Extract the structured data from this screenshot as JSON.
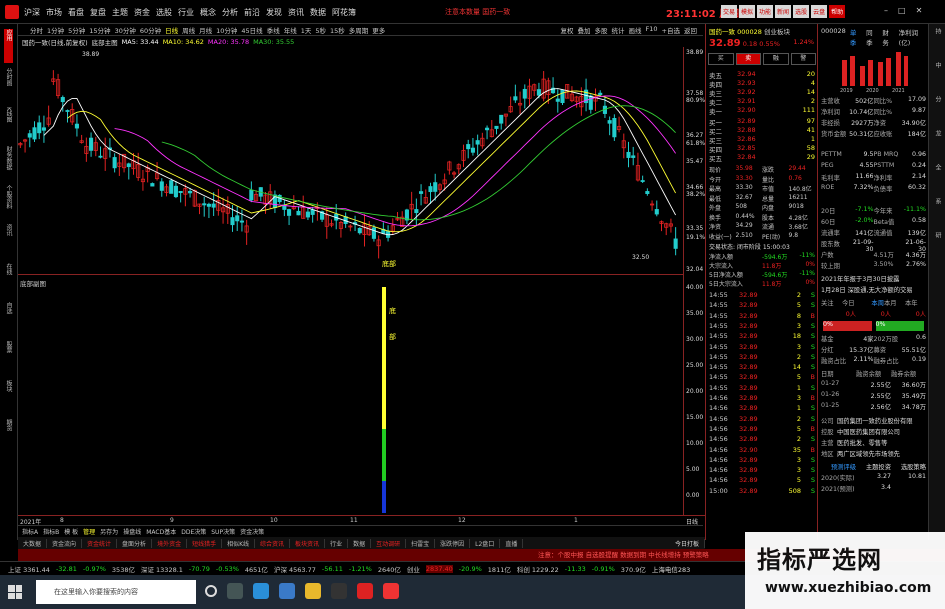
{
  "menubar": {
    "market": "沪深",
    "menus": [
      "市场",
      "看盘",
      "复盘",
      "主题",
      "资金",
      "选股",
      "行业",
      "概念",
      "分析",
      "前沿",
      "发现",
      "资讯",
      "数据",
      "阿花簿"
    ],
    "notice": "注意本数量 国药一致",
    "clock": "23:11:02",
    "weekday": "周四",
    "buttons": [
      "交易",
      "模拟",
      "功能",
      "新闻",
      "选股",
      "云盘",
      "帮助"
    ]
  },
  "left_strip": [
    "应用",
    "分时图",
    "K线图",
    "财务数据",
    "个股资料",
    "资讯",
    "在线",
    "自选",
    "股票",
    "板块",
    "期货"
  ],
  "periods": {
    "items": [
      "分时",
      "1分钟",
      "5分钟",
      "15分钟",
      "30分钟",
      "60分钟",
      "日线",
      "周线",
      "月线",
      "10分钟",
      "45日线",
      "季线",
      "年线",
      "1天",
      "5秒",
      "15秒",
      "多周期",
      "更多"
    ],
    "active": "日线",
    "right_tools": [
      "复权",
      "叠加",
      "多股",
      "统计",
      "画线",
      "F10",
      "+自选",
      "返回"
    ]
  },
  "chart_title": {
    "name": "国药一致(日线,前复权)",
    "indicator": "底部主图",
    "ma5": "MA5: 33.44",
    "ma10": "MA10: 34.62",
    "ma20": "MA20: 35.78",
    "ma30": "MA30: 35.55"
  },
  "chart_labels": {
    "high_mark": "38.89",
    "low_mark": "32.50",
    "annotation_top": "底",
    "annotation_mid": "部",
    "sub_title": "底部副图",
    "sub_annot1": "底",
    "sub_annot2": "部"
  },
  "right_axis": {
    "main": [
      "38.89",
      "37.58",
      "80.9%",
      "36.27",
      "61.8%",
      "35.47",
      "34.66",
      "38.2%",
      "33.35",
      "19.1%",
      "32.04"
    ],
    "sub": [
      "40.00",
      "35.00",
      "30.00",
      "25.00",
      "20.00",
      "15.00",
      "10.00",
      "5.00",
      "0.00"
    ],
    "period_label": "日线"
  },
  "date_bar": [
    "2021年",
    "8",
    "9",
    "10",
    "11",
    "12",
    "1"
  ],
  "tabs1": {
    "items": [
      "指标A",
      "指标B",
      "模 板",
      "管理",
      "另存为",
      "操盘线",
      "MACD基本",
      "DDE决策",
      "SUP决策",
      "资金决策"
    ],
    "active": "管理"
  },
  "tabs2": {
    "items": [
      "大数据",
      "资金流向",
      "资金统计",
      "盘面分析",
      "境外资金",
      "短线猎手",
      "相似K线",
      "综合资讯",
      "板块资讯",
      "行业",
      "数据",
      "互动调研",
      "扫雷宝",
      "涨跌停因",
      "L2盘口",
      "直播"
    ],
    "red": [
      "资金统计",
      "境外资金",
      "短线猎手",
      "综合资讯",
      "板块资讯",
      "互动调研"
    ],
    "right_label": "今日打板"
  },
  "scroll_text": "注意：个股中报 自选股提醒 数据到期 中长线增持 预警策略",
  "index_bar": {
    "sh": "上证 3361.44",
    "sh_chg": "-32.81",
    "sh_pct": "-0.97%",
    "sh_amt": "3538亿",
    "sz": "深证 13328.1",
    "sz_chg": "-70.79",
    "sz_pct": "-0.53%",
    "sz_amt": "4651亿",
    "hs": "沪深 4563.77",
    "hs_chg": "-56.11",
    "hs_pct": "-1.21%",
    "hs_amt": "2640亿",
    "cy": "创业",
    "cy_val": "2837.40",
    "cy_chg": "-20.9%",
    "cy_amt": "1811亿",
    "kc": "科创 1229.22",
    "kc_chg": "-11.33",
    "kc_pct": "-0.91%",
    "kc_amt": "370.9亿",
    "status": "上海电信283"
  },
  "taskbar": {
    "search_placeholder": "在这里输入你要搜索的内容"
  },
  "watermark": {
    "title": "指标严选网",
    "url": "www.xuezhibiao.com"
  },
  "quote": {
    "name": "国药一致",
    "code": "000028",
    "sector": "创业板块",
    "price": "32.89",
    "change": "0.18",
    "pct": "0.55%",
    "ratio": "1.24%",
    "buy_label": "买",
    "sell_label": "卖",
    "b3": "融",
    "b4": "警",
    "asks": [
      {
        "lvl": "卖五",
        "p": "32.94",
        "v": "20"
      },
      {
        "lvl": "卖四",
        "p": "32.93",
        "v": "4"
      },
      {
        "lvl": "卖三",
        "p": "32.92",
        "v": "14"
      },
      {
        "lvl": "卖二",
        "p": "32.91",
        "v": "2"
      },
      {
        "lvl": "卖一",
        "p": "32.90",
        "v": "111"
      }
    ],
    "bids": [
      {
        "lvl": "买一",
        "p": "32.89",
        "v": "97"
      },
      {
        "lvl": "买二",
        "p": "32.88",
        "v": "41"
      },
      {
        "lvl": "买三",
        "p": "32.86",
        "v": "1"
      },
      {
        "lvl": "买四",
        "p": "32.85",
        "v": "58"
      },
      {
        "lvl": "买五",
        "p": "32.84",
        "v": "29"
      }
    ],
    "stats": [
      [
        "现价",
        "35.98",
        "涨跌",
        "29.44"
      ],
      [
        "今开",
        "33.30",
        "量比",
        "0.76"
      ],
      [
        "最高",
        "33.30",
        "市值",
        "140.8亿"
      ],
      [
        "最低",
        "32.67",
        "总量",
        "16211"
      ],
      [
        "外盘",
        "508",
        "内盘",
        "9018"
      ],
      [
        "换手",
        "0.44%",
        "股本",
        "4.28亿"
      ],
      [
        "净资",
        "34.29",
        "流通",
        "3.68亿"
      ],
      [
        "收益(一)",
        "2.510",
        "PE(动)",
        "9.8"
      ]
    ],
    "trade_state": "交易状态: 闭市阶段 15:00:03",
    "flows": [
      [
        "净流入额",
        "-594.6万",
        "-11%"
      ],
      [
        "大宗流入",
        "11.8万",
        "0%"
      ],
      [
        "5日净流入额",
        "-594.6万",
        "-11%"
      ],
      [
        "5日大宗流入",
        "11.8万",
        "0%"
      ]
    ],
    "ticks": [
      [
        "14:55",
        "32.89",
        "2",
        "S"
      ],
      [
        "14:55",
        "32.89",
        "5",
        "S"
      ],
      [
        "14:55",
        "32.89",
        "8",
        "B"
      ],
      [
        "14:55",
        "32.89",
        "3",
        "S"
      ],
      [
        "14:55",
        "32.89",
        "18",
        "S"
      ],
      [
        "14:55",
        "32.89",
        "3",
        "S"
      ],
      [
        "14:55",
        "32.89",
        "2",
        "S"
      ],
      [
        "14:55",
        "32.89",
        "14",
        "S"
      ],
      [
        "14:55",
        "32.89",
        "5",
        "B"
      ],
      [
        "14:55",
        "32.89",
        "1",
        "S"
      ],
      [
        "14:56",
        "32.89",
        "3",
        "B"
      ],
      [
        "14:56",
        "32.89",
        "1",
        "S"
      ],
      [
        "14:56",
        "32.89",
        "2",
        "S"
      ],
      [
        "14:56",
        "32.89",
        "5",
        "B"
      ],
      [
        "14:56",
        "32.89",
        "2",
        "S"
      ],
      [
        "14:56",
        "32.90",
        "35",
        "B"
      ],
      [
        "14:56",
        "32.89",
        "3",
        "S"
      ],
      [
        "14:56",
        "32.89",
        "3",
        "S"
      ],
      [
        "14:56",
        "32.89",
        "5",
        "S"
      ],
      [
        "15:00",
        "32.89",
        "508",
        "S"
      ]
    ]
  },
  "fund": {
    "code": "000028",
    "tabs": [
      "单季",
      "同季",
      "财务",
      "净利润(亿)"
    ],
    "years": [
      "2019",
      "2020",
      "2021"
    ],
    "rows": [
      [
        "主营收",
        "502亿",
        "同比%",
        "17.09"
      ],
      [
        "净利润",
        "10.74亿",
        "同比%",
        "9.87"
      ],
      [
        "非经损",
        "2927万",
        "净资",
        "34.90亿"
      ],
      [
        "货币金额",
        "50.31亿",
        "应收账",
        "184亿"
      ],
      [
        "",
        "",
        "",
        ""
      ],
      [
        "PETTM",
        "9.5",
        "PB MRQ",
        "0.96"
      ],
      [
        "PEG",
        "4.55",
        "PSTTM",
        "0.24"
      ],
      [
        "毛利率",
        "11.66",
        "净利率",
        "2.14"
      ],
      [
        "ROE",
        "7.32%",
        "负债率",
        "60.32"
      ],
      [
        "",
        "",
        "",
        ""
      ],
      [
        "20日",
        "-7.1%",
        "今年来",
        "-11.1%"
      ],
      [
        "60日",
        "-2.0%",
        "Beta值",
        "0.58"
      ],
      [
        "流通率",
        "141亿",
        "流通值",
        "139亿"
      ],
      [
        "股东数",
        "21-09-30",
        "",
        "21-06-30"
      ],
      [
        "户数",
        "",
        "4.51万",
        "4.36万"
      ],
      [
        "较上期",
        "",
        "3.50%",
        "2.76%"
      ]
    ],
    "news1": "2021年年报于3月30日披露",
    "news2": "1月28日 深股通,无大净额的交易",
    "attention": [
      "关注",
      "今日",
      "本周",
      "本月",
      "本年"
    ],
    "att_vals": [
      "0人",
      "0人",
      "0人"
    ],
    "pct_bars": [
      "0%",
      "0%"
    ],
    "fund_stats": [
      [
        "基金",
        "4家",
        "202万股",
        "0.6"
      ],
      [
        "分红",
        "15.37亿",
        "募资",
        "55.51亿"
      ],
      [
        "融资占比",
        "2.11%",
        "融券占比",
        "0.19"
      ]
    ],
    "margin_head": [
      "日期",
      "融资余额",
      "融券余额"
    ],
    "margin": [
      [
        "01-27",
        "2.55亿",
        "36.60万"
      ],
      [
        "01-26",
        "2.55亿",
        "35.49万"
      ],
      [
        "01-25",
        "2.56亿",
        "34.78万"
      ]
    ],
    "company": [
      [
        "公司",
        "国药集团一致药业股份有限"
      ],
      [
        "控股",
        "中国医药集团有限公司"
      ],
      [
        "主营",
        "医药批发、零售等"
      ],
      [
        "地区",
        "两广区域领先市场领先"
      ]
    ],
    "forecast_tabs": [
      "预测评级",
      "主题投资",
      "选股策略"
    ],
    "forecast": [
      [
        "2020(实际)",
        "3.27",
        "10.81"
      ],
      [
        "2021(预测)",
        "3.4",
        ""
      ]
    ]
  },
  "far_right": [
    "持",
    "中",
    "分",
    "龙",
    "全",
    "系",
    "研"
  ],
  "colors": {
    "up": "#e22222",
    "down": "#22cccc",
    "ma5": "#ffffff",
    "ma10": "#ffff33",
    "ma20": "#ff33ff",
    "ma30": "#33cc33"
  }
}
